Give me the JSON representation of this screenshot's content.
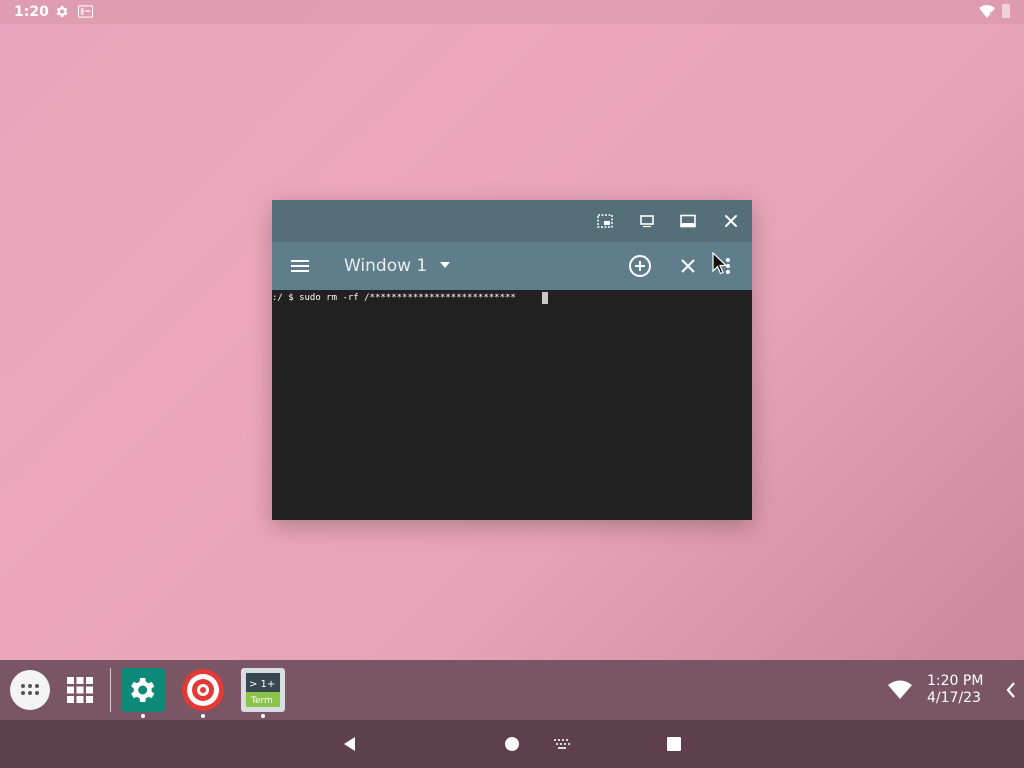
{
  "status_bar": {
    "time": "1:20",
    "icons": [
      "gear-icon",
      "accessibility-icon",
      "wifi-alert-icon",
      "battery-icon"
    ]
  },
  "window": {
    "caption_buttons": [
      "screenshot-icon",
      "restore-icon",
      "maximize-icon",
      "close-icon"
    ],
    "toolbar": {
      "menu_icon": "hamburger-menu-icon",
      "title": "Window 1",
      "dropdown_icon": "dropdown-arrow-icon",
      "new_window_icon": "add-circle-icon",
      "close_window_icon": "close-icon",
      "overflow_icon": "more-vert-icon"
    },
    "terminal": {
      "command_line": ":/ $ sudo rm -rf /***************************"
    }
  },
  "taskbar": {
    "apps": [
      {
        "name": "Settings",
        "icon": "settings-app-icon",
        "color": "#0f8a7a"
      },
      {
        "name": "Target",
        "icon": "target-app-icon",
        "color": "#e53935"
      },
      {
        "name": "Terminal",
        "icon": "terminal-app-icon",
        "label_top": "> 1+",
        "label_bottom": "Term"
      }
    ],
    "clock_time": "1:20 PM",
    "clock_date": "4/17/23"
  },
  "nav_bar": {
    "buttons": [
      "back-icon",
      "home-icon",
      "keyboard-icon",
      "recents-icon"
    ]
  },
  "colors": {
    "caption_bar": "#546e7a",
    "toolbar": "#607d8b",
    "terminal_bg": "#212121",
    "taskbar": "#7a5563",
    "navbar": "#5e3f4c"
  }
}
